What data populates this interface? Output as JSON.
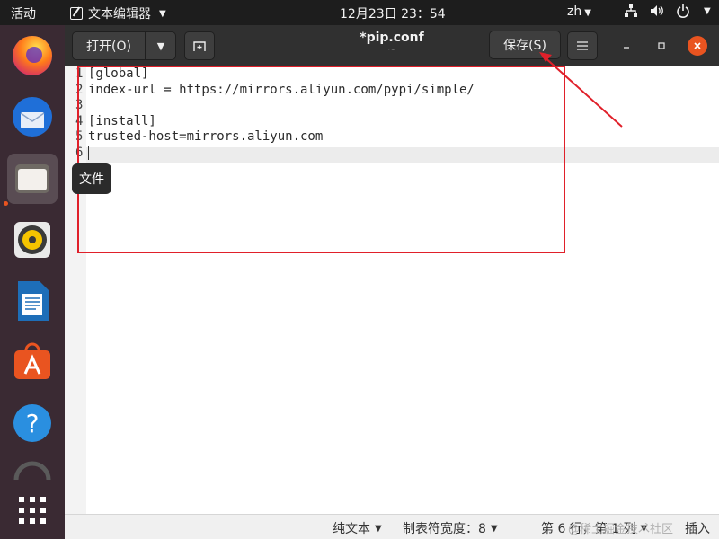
{
  "topbar": {
    "activities": "活动",
    "app_name": "文本编辑器",
    "clock": "12月23日  23：54",
    "lang": "zh"
  },
  "dock": {
    "tooltip": "文件",
    "items": [
      "firefox-icon",
      "thunderbird-icon",
      "files-icon",
      "rhythmbox-icon",
      "libreoffice-writer-icon",
      "software-center-icon",
      "help-icon",
      "more-app-icon",
      "show-apps-icon"
    ]
  },
  "window": {
    "open_label": "打开(O)",
    "title": "*pip.conf",
    "subtitle": "~",
    "save_label": "保存(S)"
  },
  "editor": {
    "lines": [
      {
        "num": "1",
        "text": "[global]"
      },
      {
        "num": "2",
        "text": "index-url = https://mirrors.aliyun.com/pypi/simple/"
      },
      {
        "num": "3",
        "text": ""
      },
      {
        "num": "4",
        "text": "[install]"
      },
      {
        "num": "5",
        "text": "trusted-host=mirrors.aliyun.com"
      },
      {
        "num": "6",
        "text": ""
      }
    ]
  },
  "statusbar": {
    "syntax": "纯文本",
    "tab_width": "制表符宽度：8",
    "position": "第 6 行，第 1 列",
    "mode": "插入",
    "watermark": "@稀土掘金技术社区"
  },
  "colors": {
    "accent": "#e95420",
    "annotation": "#e0202a"
  }
}
